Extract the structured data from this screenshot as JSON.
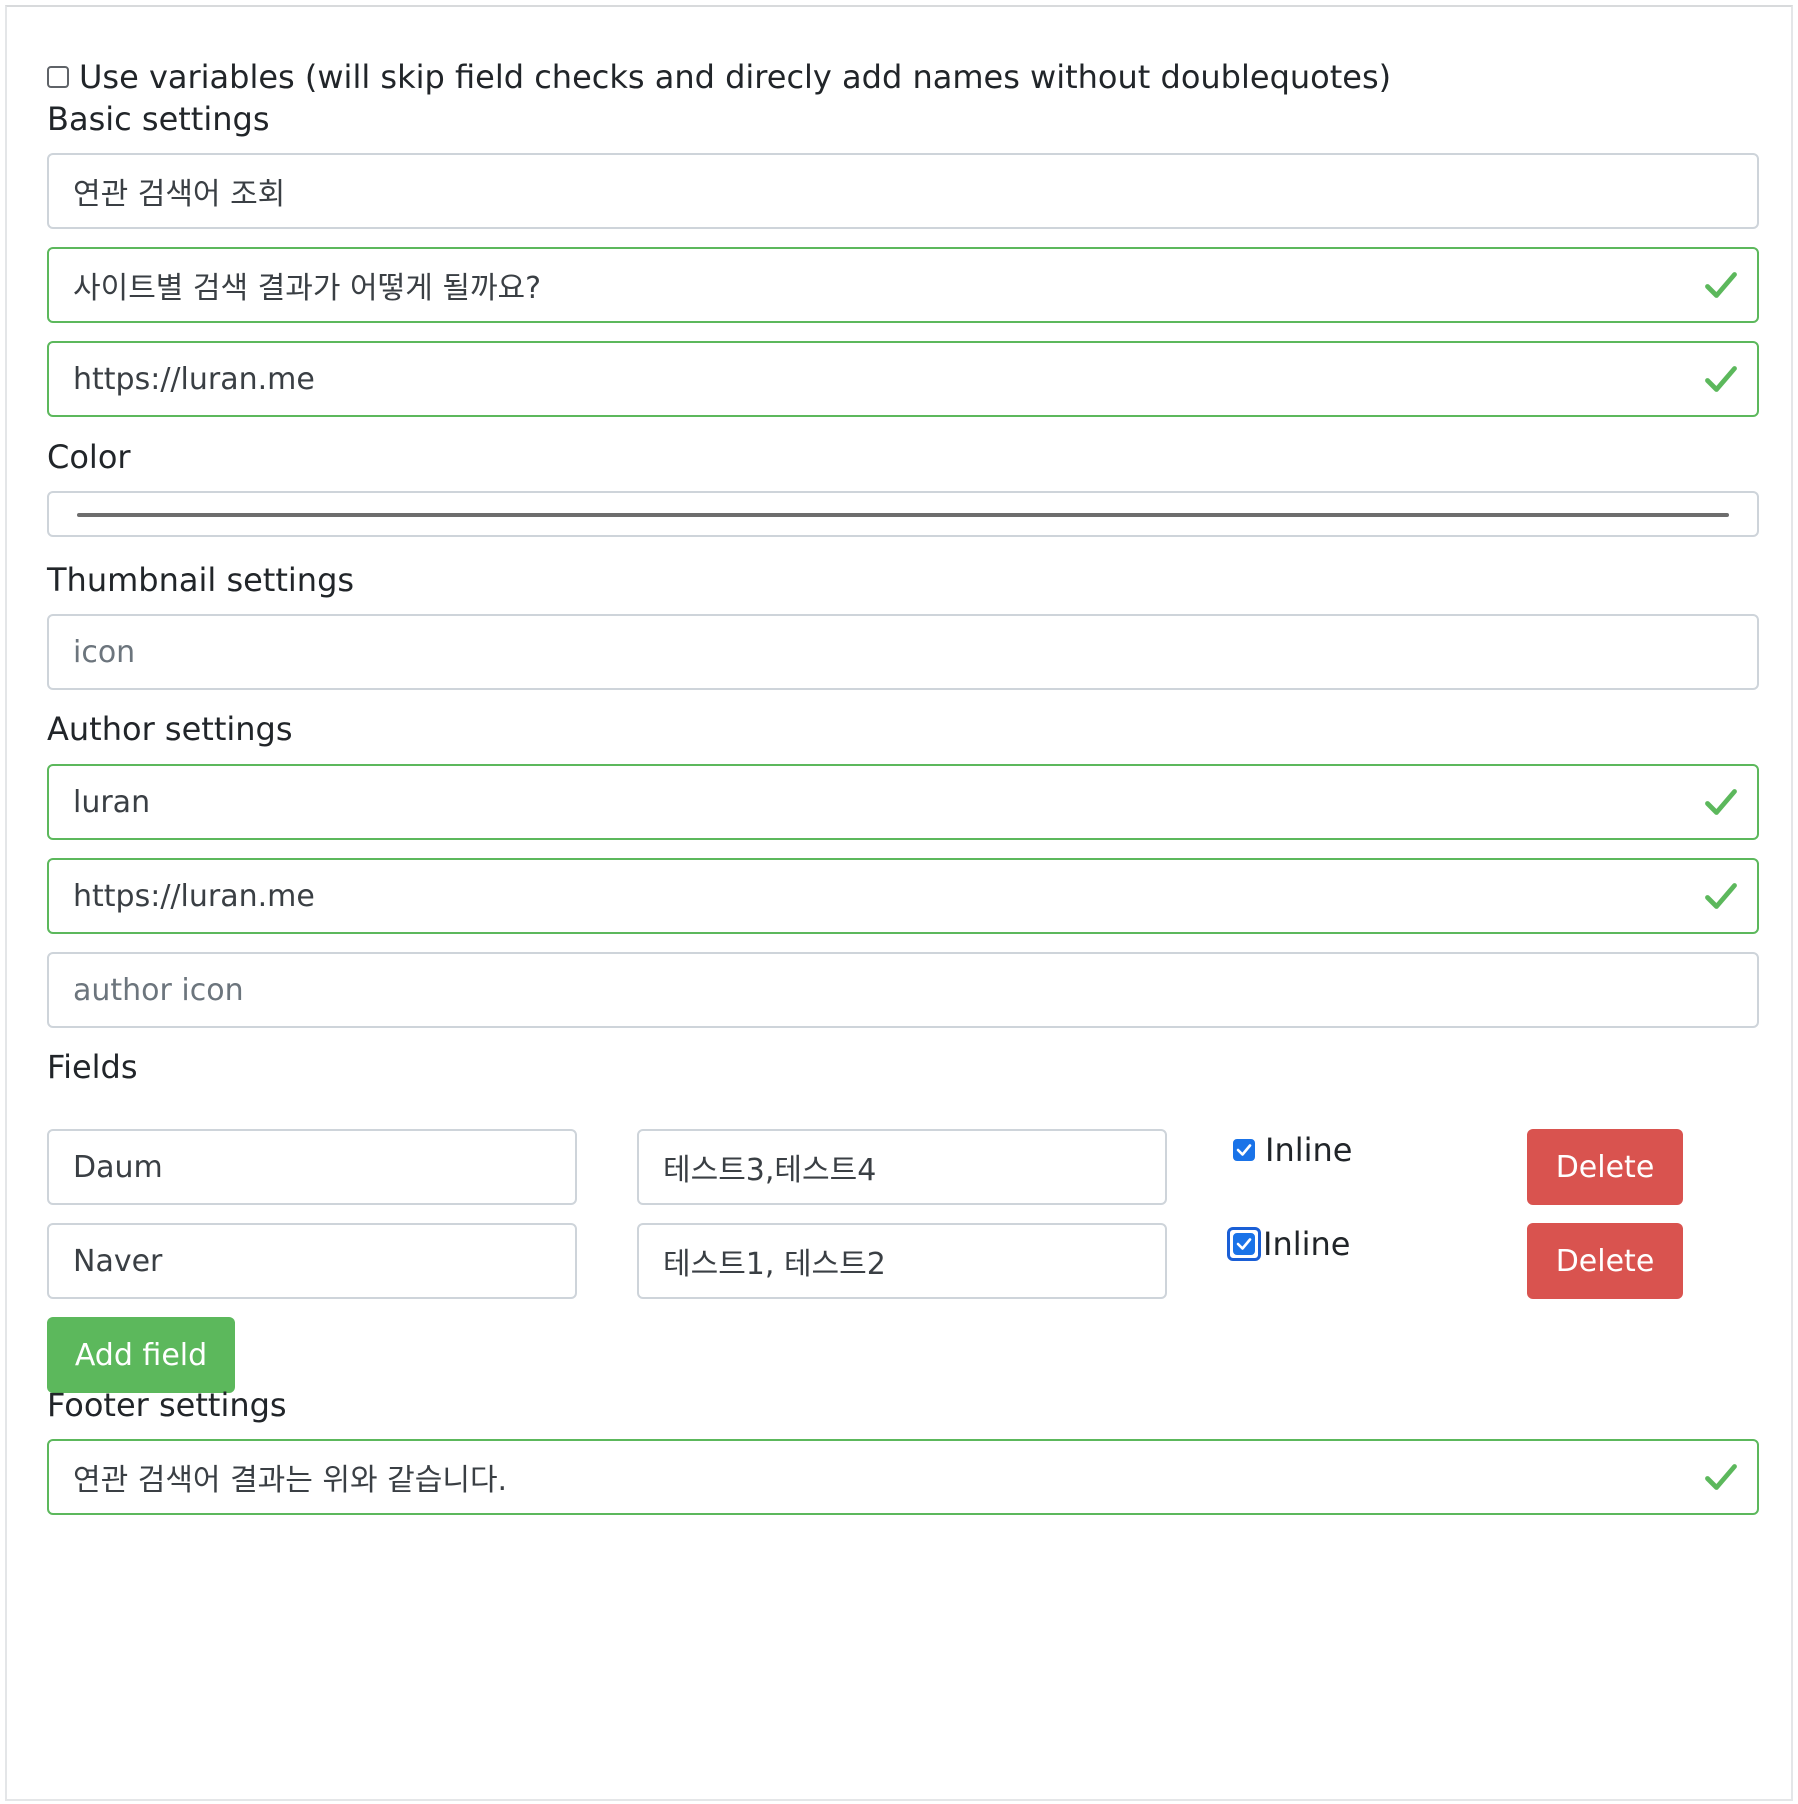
{
  "use_variables": {
    "checked": false,
    "label": "Use variables (will skip field checks and direcly add names without doublequotes)"
  },
  "basic_settings": {
    "heading": "Basic settings",
    "title_value": "연관 검색어 조회",
    "description_value": "사이트별 검색 결과가 어떻게 될까요?",
    "url_value": "https://luran.me"
  },
  "color": {
    "heading": "Color",
    "value": "#6d6d6d"
  },
  "thumbnail_settings": {
    "heading": "Thumbnail settings",
    "icon_placeholder": "icon"
  },
  "author_settings": {
    "heading": "Author settings",
    "name_value": "luran",
    "url_value": "https://luran.me",
    "icon_placeholder": "author icon"
  },
  "fields": {
    "heading": "Fields",
    "rows": [
      {
        "name": "Daum",
        "value": "테스트3,테스트4",
        "inline_checked": true,
        "inline_label": "Inline",
        "delete_label": "Delete"
      },
      {
        "name": "Naver",
        "value": "테스트1, 테스트2",
        "inline_checked": true,
        "inline_label": "Inline",
        "delete_label": "Delete"
      }
    ],
    "add_label": "Add field"
  },
  "footer_settings": {
    "heading": "Footer settings",
    "text_value": "연관 검색어 결과는 위와 같습니다."
  },
  "colors": {
    "valid_border": "#5cb85c",
    "valid_check": "#5cb85c",
    "delete_button": "#d9534f",
    "add_button": "#5cb85c",
    "checkbox_checked": "#1a73e8"
  }
}
